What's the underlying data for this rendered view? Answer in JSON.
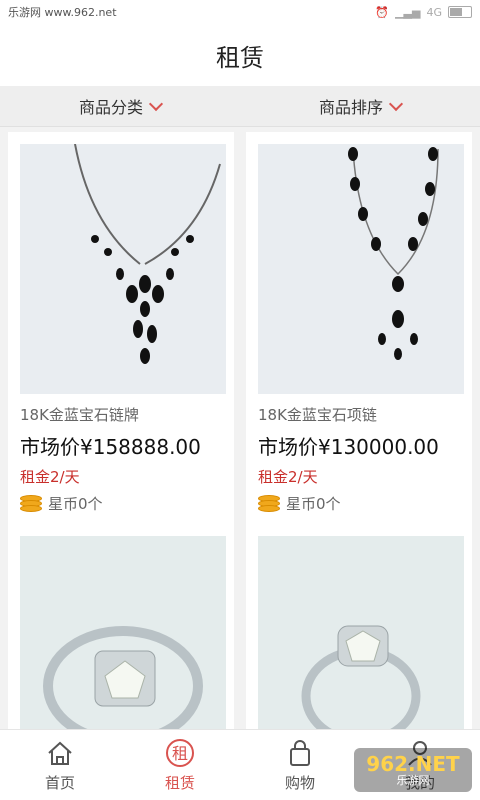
{
  "status_bar": {
    "site": "乐游网 www.962.net",
    "network": "4G"
  },
  "header": {
    "title": "租赁"
  },
  "filters": [
    {
      "label": "商品分类"
    },
    {
      "label": "商品排序"
    }
  ],
  "products": [
    {
      "name": "18K金蓝宝石链牌",
      "price": "市场价¥158888.00",
      "rent": "租金2/天",
      "coins": "星币0个",
      "image": "necklace-pendant"
    },
    {
      "name": "18K金蓝宝石项链",
      "price": "市场价¥130000.00",
      "rent": "租金2/天",
      "coins": "星币0个",
      "image": "necklace-long"
    },
    {
      "image": "diamond-ring"
    },
    {
      "image": "diamond-ring-2"
    }
  ],
  "tabbar": [
    {
      "label": "首页",
      "icon": "home-icon"
    },
    {
      "label": "租赁",
      "icon": "rent-icon",
      "active": true
    },
    {
      "label": "购物",
      "icon": "bag-icon"
    },
    {
      "label": "我的",
      "icon": "user-icon"
    }
  ],
  "watermark": {
    "logo": "962",
    "suffix": ".NET",
    "text": "乐游网"
  },
  "colors": {
    "accent": "#d9534f",
    "rent_red": "#c9302c",
    "coin": "#f0a81c"
  }
}
